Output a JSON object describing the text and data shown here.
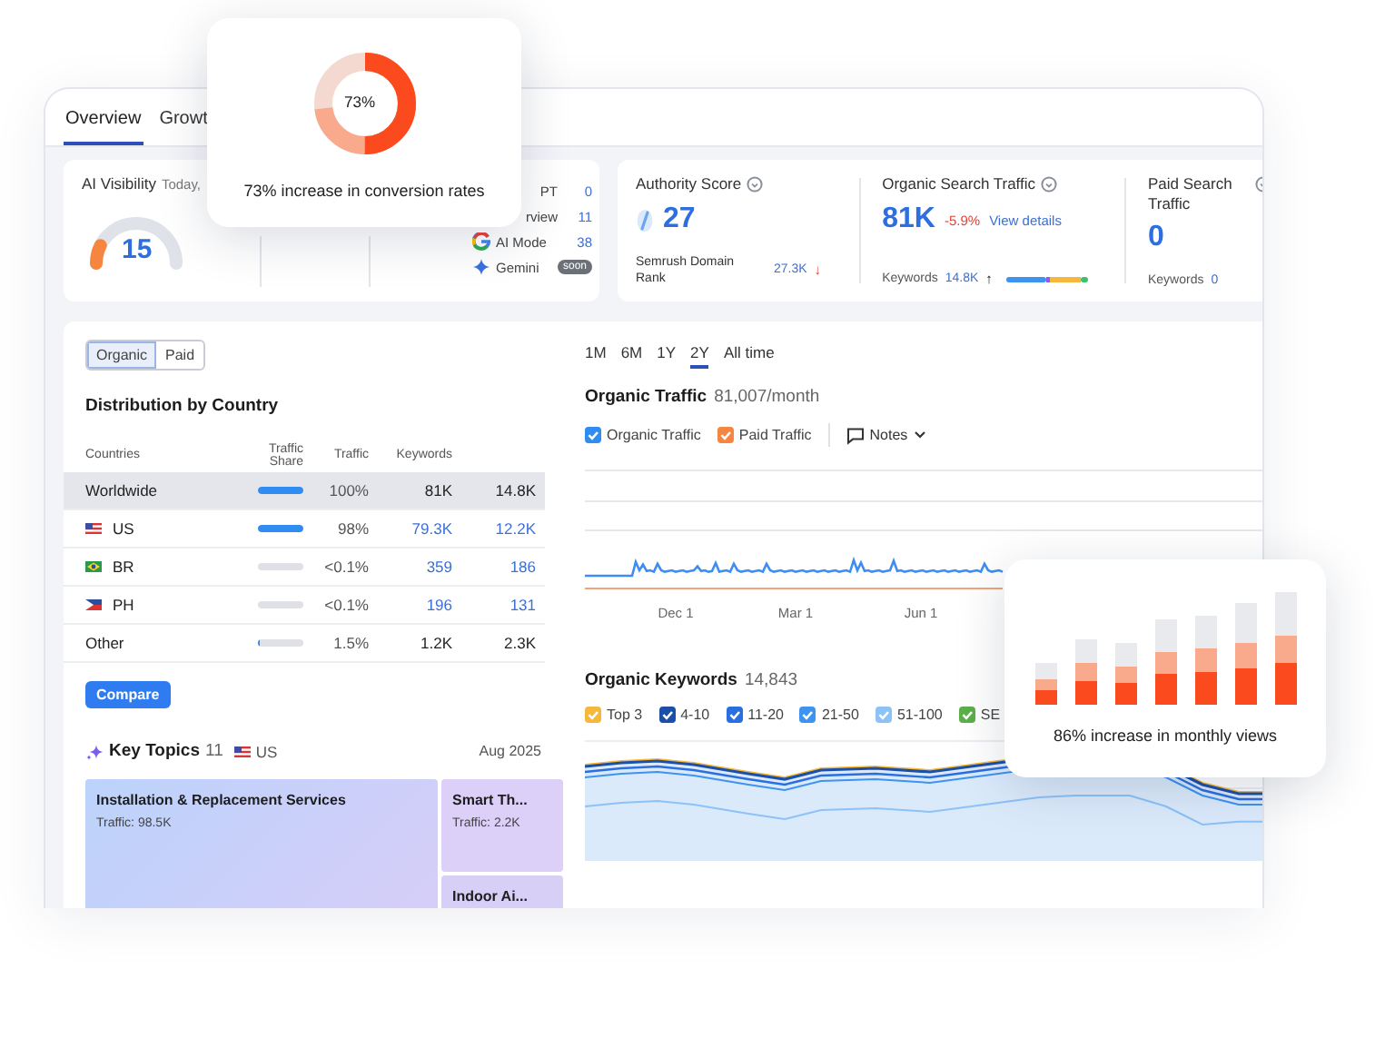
{
  "tabs": [
    {
      "label": "Overview",
      "selected": true
    },
    {
      "label": "Growt",
      "selected": false
    }
  ],
  "ai_visibility": {
    "title": "AI Visibility",
    "date": "Today,",
    "score": "15",
    "sources": [
      {
        "kind": "cut",
        "name": "PT",
        "value": "0"
      },
      {
        "kind": "cut",
        "name": "rview",
        "value": "11"
      },
      {
        "kind": "google",
        "name": "AI Mode",
        "value": "38"
      },
      {
        "kind": "gemini",
        "name": "Gemini",
        "badge": "soon"
      }
    ]
  },
  "authority": {
    "title": "Authority Score",
    "score": "27",
    "rank_label": "Semrush Domain Rank",
    "rank_value": "27.3K",
    "rank_arrow": "↓"
  },
  "organic_search": {
    "title": "Organic Search Traffic",
    "value": "81K",
    "change": "-5.9%",
    "link": "View details",
    "keywords_label": "Keywords",
    "keywords_value": "14.8K",
    "keywords_arrow": "↑"
  },
  "paid_search": {
    "title": "Paid Search Traffic",
    "value": "0",
    "keywords_label": "Keywords",
    "keywords_value": "0"
  },
  "traffic_toggle": [
    {
      "label": "Organic",
      "selected": true
    },
    {
      "label": "Paid",
      "selected": false
    }
  ],
  "distribution": {
    "title": "Distribution by Country",
    "columns": [
      "Countries",
      "Traffic Share",
      "Traffic",
      "Keywords"
    ],
    "rows": [
      {
        "kind": "none",
        "country": "Worldwide",
        "level": 1,
        "share": "100%",
        "traffic": "81K",
        "keywords": "14.8K",
        "selected": true,
        "linked": false
      },
      {
        "kind": "us",
        "country": "US",
        "level": 0.98,
        "share": "98%",
        "traffic": "79.3K",
        "keywords": "12.2K",
        "selected": false,
        "linked": true
      },
      {
        "kind": "br",
        "country": "BR",
        "level": 0,
        "share": "<0.1%",
        "traffic": "359",
        "keywords": "186",
        "selected": false,
        "linked": true
      },
      {
        "kind": "ph",
        "country": "PH",
        "level": 0,
        "share": "<0.1%",
        "traffic": "196",
        "keywords": "131",
        "selected": false,
        "linked": true
      },
      {
        "kind": "none",
        "country": "Other",
        "level": 0.015,
        "share": "1.5%",
        "traffic": "1.2K",
        "keywords": "2.3K",
        "selected": false,
        "linked": false
      }
    ]
  },
  "compare_button": "Compare",
  "key_topics": {
    "title": "Key Topics",
    "count": "11",
    "country": "US",
    "date": "Aug 2025",
    "topics": [
      {
        "name": "Installation & Replacement Services",
        "traffic": "Traffic: 98.5K"
      },
      {
        "name": "Smart Th...",
        "traffic": "Traffic: 2.2K"
      },
      {
        "name": "Indoor Ai..."
      }
    ]
  },
  "periods": [
    {
      "label": "1M",
      "selected": false
    },
    {
      "label": "6M",
      "selected": false
    },
    {
      "label": "1Y",
      "selected": false
    },
    {
      "label": "2Y",
      "selected": true
    },
    {
      "label": "All time",
      "selected": false
    }
  ],
  "organic_traffic": {
    "title": "Organic Traffic",
    "value": "81,007/month",
    "legend": [
      {
        "label": "Organic Traffic",
        "color": "#2f8cf0",
        "checked": true
      },
      {
        "label": "Paid Traffic",
        "color": "#f5853f",
        "checked": true
      }
    ],
    "notes": "Notes",
    "x_labels": [
      "Dec 1",
      "Mar 1",
      "Jun 1"
    ]
  },
  "organic_keywords": {
    "title": "Organic Keywords",
    "value": "14,843",
    "legend": [
      {
        "label": "Top 3",
        "color": "#f5b83d",
        "checked": true
      },
      {
        "label": "4-10",
        "color": "#1b4fa8",
        "checked": true
      },
      {
        "label": "11-20",
        "color": "#2a6fe0",
        "checked": true
      },
      {
        "label": "21-50",
        "color": "#3d93f0",
        "checked": true
      },
      {
        "label": "51-100",
        "color": "#8cc2f8",
        "checked": true
      },
      {
        "label": "SE",
        "color": "#5bb04a",
        "checked": true
      }
    ]
  },
  "promo_cards": [
    {
      "kind": "donut",
      "value": "73%",
      "caption": "73% increase in conversion rates"
    },
    {
      "kind": "bars",
      "caption": "86% increase in monthly views"
    }
  ]
}
